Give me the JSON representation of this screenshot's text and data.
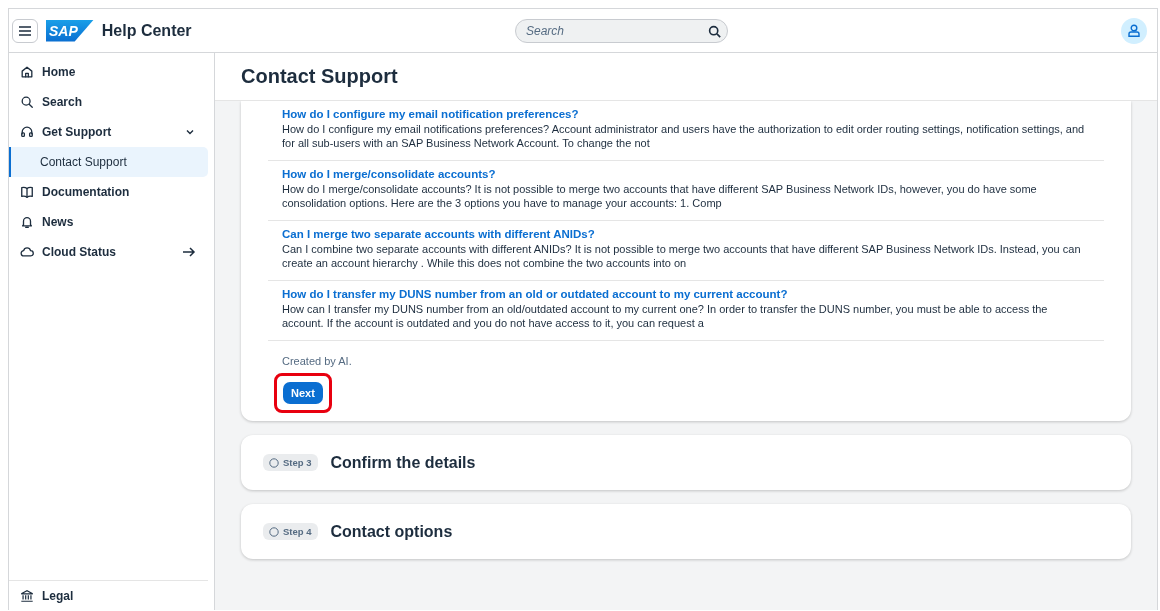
{
  "header": {
    "logo_text": "SAP",
    "title": "Help Center",
    "search": {
      "placeholder": "Search"
    }
  },
  "sidebar": {
    "items": [
      {
        "label": "Home",
        "kind": "page",
        "selected": false
      },
      {
        "label": "Search",
        "kind": "page",
        "selected": false
      },
      {
        "label": "Get Support",
        "kind": "group",
        "selected": false,
        "expanded": true,
        "children": [
          {
            "label": "Contact Support",
            "selected": true
          }
        ]
      },
      {
        "label": "Documentation",
        "kind": "page",
        "selected": false
      },
      {
        "label": "News",
        "kind": "page",
        "selected": false
      },
      {
        "label": "Cloud Status",
        "kind": "external",
        "selected": false
      }
    ],
    "footer": {
      "label": "Legal"
    }
  },
  "page_title": "Contact Support",
  "faqs": [
    {
      "question": "How do I configure my email notification preferences?",
      "answer": "How do I configure my email notifications preferences? Account administrator and users have the authorization to edit order routing settings, notification settings, and for all sub-users with an SAP Business Network Account. To change the not"
    },
    {
      "question": "How do I merge/consolidate accounts?",
      "answer": "How do I merge/consolidate accounts? It is not possible to merge two accounts that have different SAP Business Network IDs, however, you do have some consolidation options. Here are the 3 options you have to manage your accounts: 1. Comp"
    },
    {
      "question": "Can I merge two separate accounts with different ANIDs?",
      "answer": "Can I combine two separate accounts with different ANIDs? It is not possible to merge two accounts that have different SAP Business Network IDs. Instead, you can create an account hierarchy . While this does not combine the two accounts into on"
    },
    {
      "question": "How do I transfer my DUNS number from an old or outdated account to my current account?",
      "answer": "How can I transfer my DUNS number from an old/outdated account to my current one? In order to transfer the DUNS number, you must be able to access the account. If the account is outdated and you do not have access to it, you can request a"
    }
  ],
  "ai_note": "Created by AI.",
  "next_button": {
    "label": "Next",
    "highlighted": true
  },
  "steps": [
    {
      "badge": "Step 3",
      "title": "Confirm the details",
      "done": false
    },
    {
      "badge": "Step 4",
      "title": "Contact options",
      "done": false
    }
  ]
}
